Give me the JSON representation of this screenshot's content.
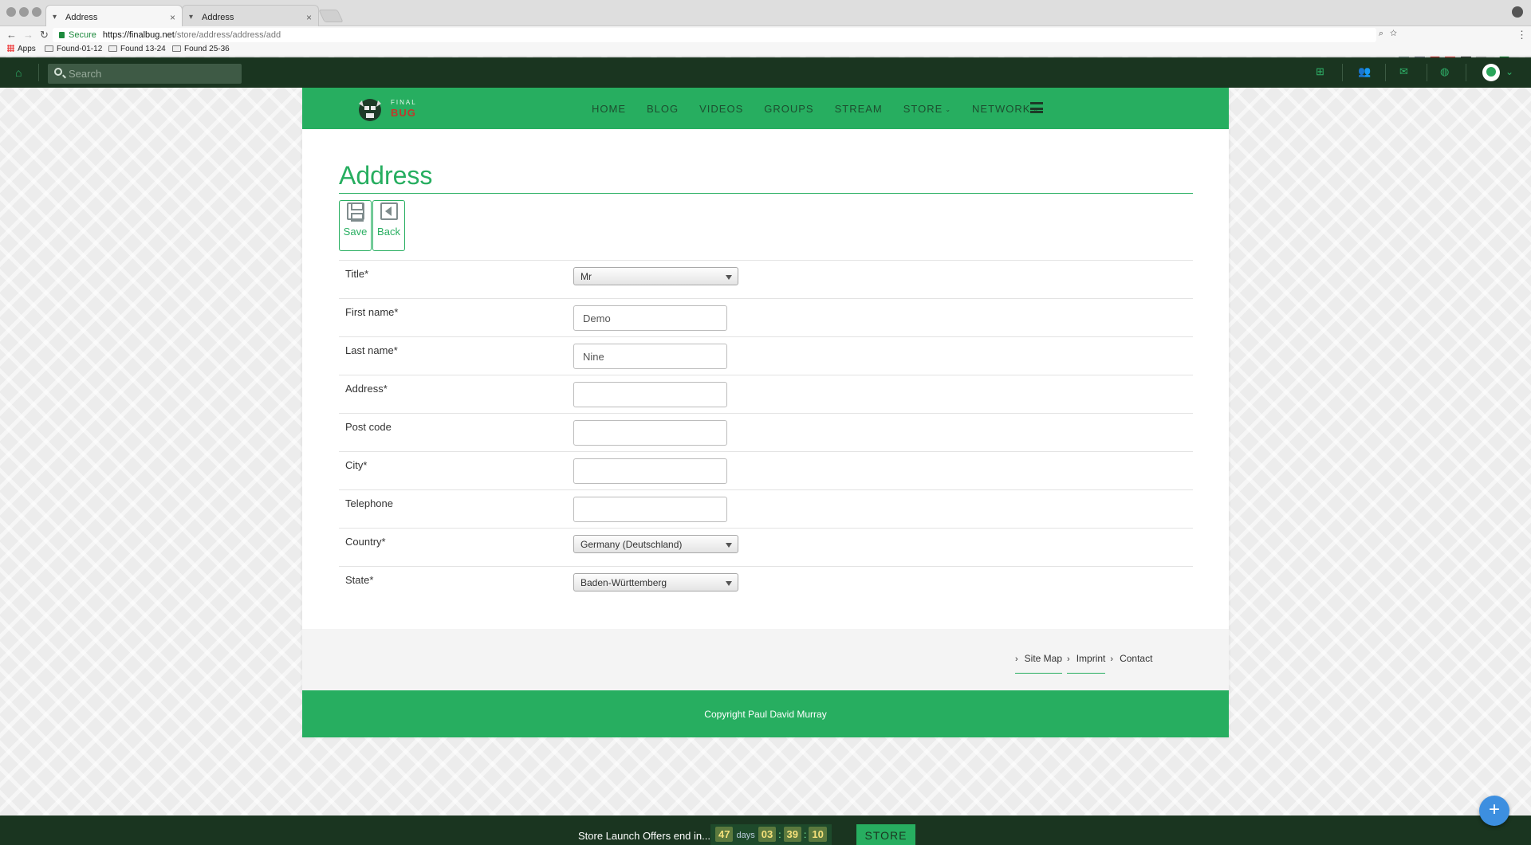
{
  "browser": {
    "tabs": [
      {
        "title": "Address",
        "close": "×"
      },
      {
        "title": "Address",
        "close": "×"
      }
    ],
    "secure_label": "Secure",
    "url_host": "https://finalbug.net",
    "url_path": "/store/address/address/add",
    "bookmarks": [
      "Apps",
      "Found-01-12",
      "Found 13-24",
      "Found 25-36"
    ]
  },
  "topbar": {
    "search_placeholder": "Search"
  },
  "site": {
    "logo_top": "FINAL",
    "logo_bottom": "BUG",
    "menu": [
      {
        "label": "HOME"
      },
      {
        "label": "BLOG"
      },
      {
        "label": "VIDEOS"
      },
      {
        "label": "GROUPS"
      },
      {
        "label": "STREAM"
      },
      {
        "label": "STORE",
        "caret": "⌄"
      },
      {
        "label": "NETWORK",
        "caret": "⌄"
      }
    ]
  },
  "page": {
    "title": "Address",
    "toolbar": {
      "save": "Save",
      "back": "Back"
    },
    "fields": [
      {
        "label": "Title*",
        "type": "select",
        "value": "Mr"
      },
      {
        "label": "First name*",
        "type": "input",
        "value": "Demo"
      },
      {
        "label": "Last name*",
        "type": "input",
        "value": "Nine"
      },
      {
        "label": "Address*",
        "type": "input",
        "value": ""
      },
      {
        "label": "Post code",
        "type": "input",
        "value": ""
      },
      {
        "label": "City*",
        "type": "input",
        "value": ""
      },
      {
        "label": "Telephone",
        "type": "input",
        "value": ""
      },
      {
        "label": "Country*",
        "type": "select",
        "value": "Germany (Deutschland)"
      },
      {
        "label": "State*",
        "type": "select",
        "value": "Baden-Württemberg"
      }
    ]
  },
  "footer": {
    "links": [
      "Site Map",
      "Imprint",
      "Contact"
    ],
    "copyright": "Copyright Paul David Murray"
  },
  "promo": {
    "text": "Store Launch Offers end in...",
    "days": "47",
    "days_label": "days",
    "hours": "03",
    "minutes": "39",
    "seconds": "10",
    "store_button": "STORE"
  },
  "colors": {
    "brand_green": "#27ae60",
    "dark_green": "#1a3520",
    "fab_blue": "#3d8fe0"
  }
}
